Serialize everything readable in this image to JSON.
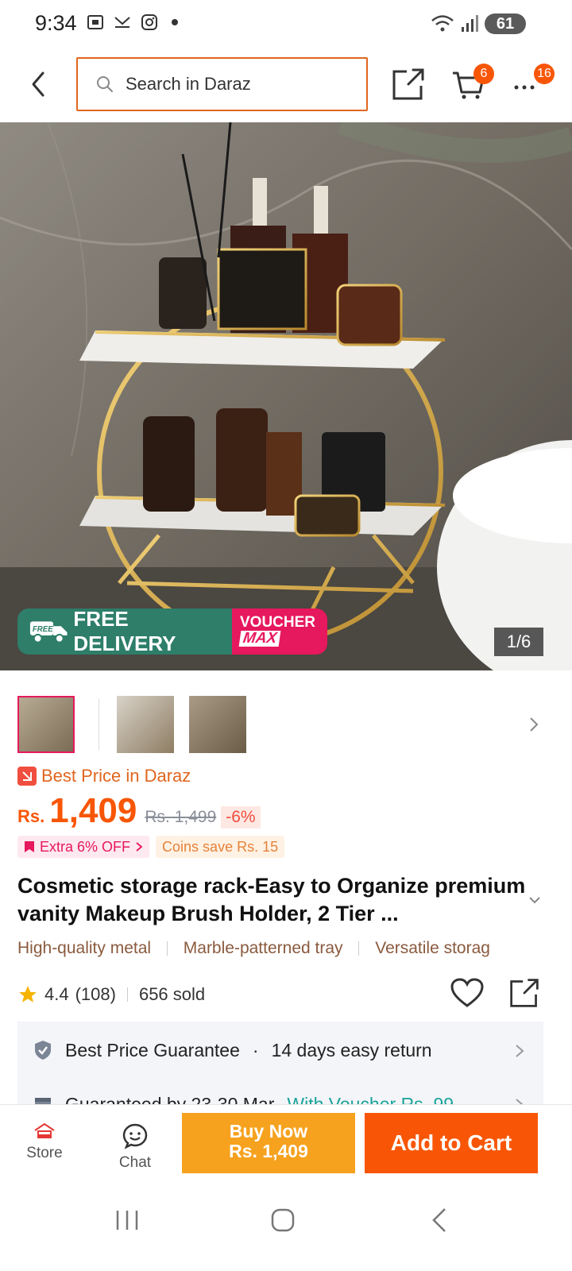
{
  "status_bar": {
    "time": "9:34",
    "battery": "61"
  },
  "search": {
    "placeholder": "Search in Daraz"
  },
  "header": {
    "cart_count": "6",
    "more_count": "16"
  },
  "gallery": {
    "free_delivery": "FREE DELIVERY",
    "free_badge": "FREE",
    "voucher_line1": "VOUCHER",
    "voucher_line2": "MAX",
    "counter": "1/6"
  },
  "price": {
    "best_price_label": "Best Price in Daraz",
    "currency": "Rs.",
    "current": "1,409",
    "original": "Rs. 1,499",
    "discount": "-6%",
    "extra_off": "Extra 6% OFF",
    "coins": "Coins save Rs. 15"
  },
  "product": {
    "title": "Cosmetic storage rack-Easy to Organize premium vanity Makeup Brush Holder, 2 Tier ...",
    "tags": [
      "High-quality metal",
      "Marble-patterned tray",
      "Versatile storag"
    ],
    "rating": "4.4",
    "reviews": "(108)",
    "sold": "656 sold"
  },
  "guarantee": {
    "best_price": "Best Price Guarantee",
    "dot": "·",
    "returns": "14 days easy return",
    "delivery": "Guaranteed by 23-30 Mar",
    "voucher": "With Voucher Rs. 99"
  },
  "bottom_bar": {
    "store_label": "Store",
    "chat_label": "Chat",
    "buy_now_line1": "Buy Now",
    "buy_now_line2": "Rs. 1,409",
    "add_to_cart": "Add to Cart"
  },
  "colors": {
    "brand_orange": "#f85606",
    "buy_now_yellow": "#f6a21e",
    "voucher_pink": "#e6185e",
    "delivery_green": "#2e7e6a"
  }
}
